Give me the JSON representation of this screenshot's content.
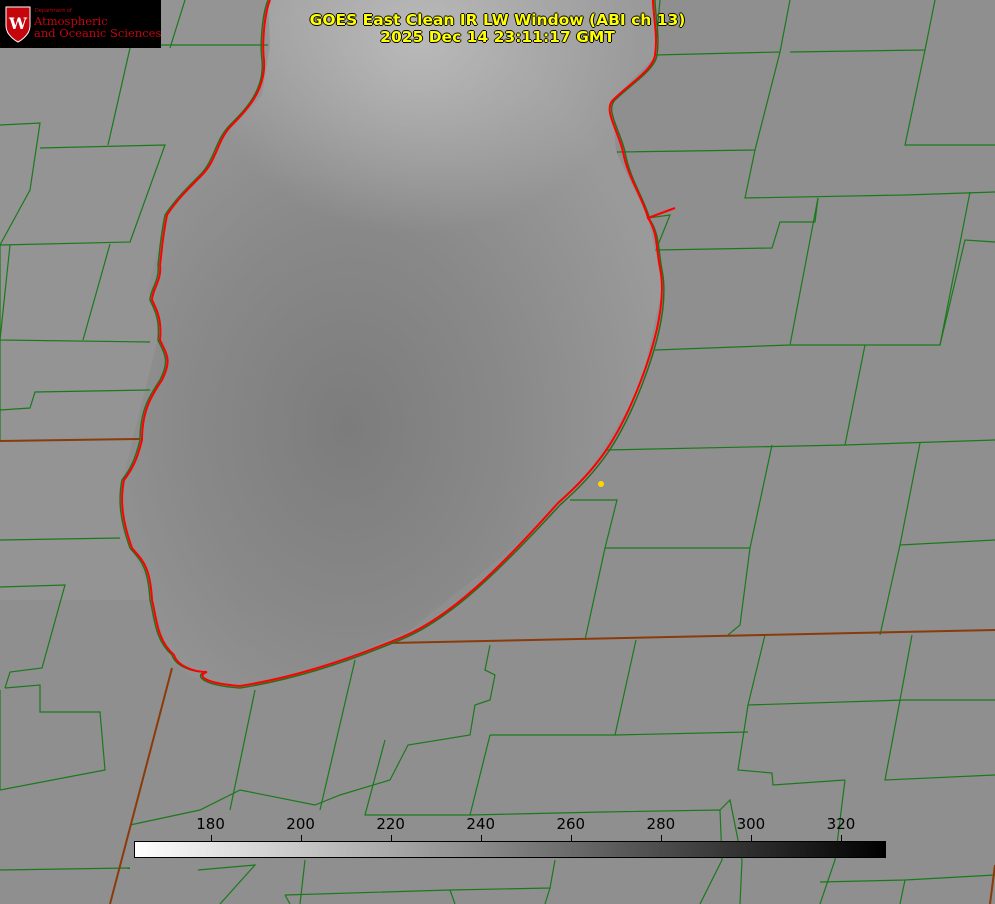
{
  "header": {
    "title_line1": "GOES East Clean IR LW Window (ABI ch 13)",
    "title_line2": "2025 Dec 14 23:11:17 GMT"
  },
  "logo": {
    "department": "Department of",
    "line1": "Atmospheric",
    "line2": "and Oceanic Sciences",
    "seal_letter": "W"
  },
  "colorbar": {
    "ticks": [
      "180",
      "200",
      "220",
      "240",
      "260",
      "280",
      "300",
      "320"
    ],
    "min": 163,
    "max": 330,
    "gradient_start": "#ffffff",
    "gradient_end": "#000000"
  },
  "colors": {
    "title": "#ffff00",
    "coastline": "#ff0000",
    "county_lines": "#1a7a1a",
    "state_lines": "#8b3a0a",
    "marker": "#ffd700",
    "logo_red": "#c5050c"
  }
}
